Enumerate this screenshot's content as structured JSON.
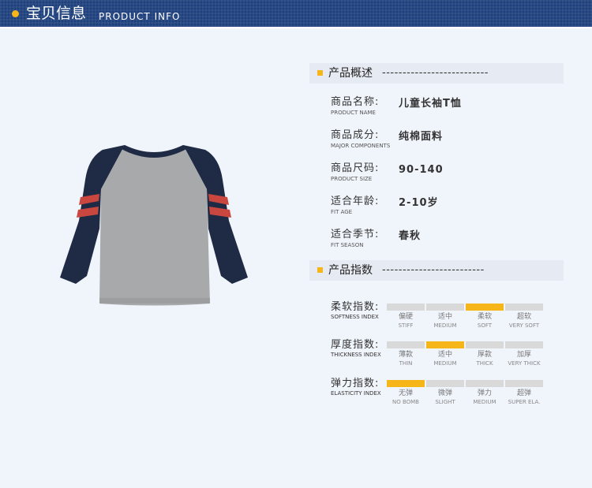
{
  "header": {
    "title": "宝贝信息",
    "subtitle": "PRODUCT INFO"
  },
  "colors": {
    "header_bg": "#1d3f7c",
    "accent": "#f6b519",
    "bar_off": "#d9d9d9",
    "shirt_body": "#a8a9ab",
    "shirt_sleeve": "#1f2a44",
    "stripe": "#c9473f"
  },
  "overview": {
    "title": "产品概述",
    "dashes": "--------------------------",
    "rows": [
      {
        "cn": "商品名称:",
        "en": "PRODUCT NAME",
        "value": "儿童长袖T恤"
      },
      {
        "cn": "商品成分:",
        "en": "MAJOR COMPONENTS",
        "value": "纯棉面料"
      },
      {
        "cn": "商品尺码:",
        "en": "PRODUCT SIZE",
        "value": "90-140"
      },
      {
        "cn": "适合年龄:",
        "en": "FIT AGE",
        "value": "2-10岁"
      },
      {
        "cn": "适合季节:",
        "en": "FIT SEASON",
        "value": "春秋"
      }
    ]
  },
  "indices": {
    "title": "产品指数",
    "dashes": "-------------------------",
    "rows": [
      {
        "cn": "柔软指数:",
        "en": "SOFTNESS INDEX",
        "selected": 2,
        "options": [
          {
            "cn": "偏硬",
            "en": "STIFF"
          },
          {
            "cn": "适中",
            "en": "MEDIUM"
          },
          {
            "cn": "柔软",
            "en": "SOFT"
          },
          {
            "cn": "超软",
            "en": "VERY SOFT"
          }
        ]
      },
      {
        "cn": "厚度指数:",
        "en": "THICKNESS INDEX",
        "selected": 1,
        "options": [
          {
            "cn": "薄款",
            "en": "THIN"
          },
          {
            "cn": "适中",
            "en": "MEDIUM"
          },
          {
            "cn": "厚款",
            "en": "THICK"
          },
          {
            "cn": "加厚",
            "en": "VERY THICK"
          }
        ]
      },
      {
        "cn": "弹力指数:",
        "en": "ELASTICITY INDEX",
        "selected": 0,
        "options": [
          {
            "cn": "无弹",
            "en": "NO BOMB"
          },
          {
            "cn": "微弹",
            "en": "SLIGHT"
          },
          {
            "cn": "弹力",
            "en": "MEDIUM"
          },
          {
            "cn": "超弹",
            "en": "SUPER ELA."
          }
        ]
      }
    ]
  }
}
